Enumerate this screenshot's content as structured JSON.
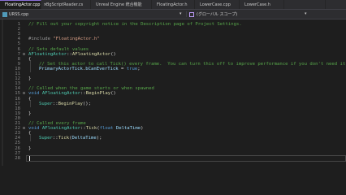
{
  "tabs": [
    {
      "label": "FloatingActor.cpp",
      "active": true
    },
    {
      "label": "BgScriptReader.cs",
      "active": false
    },
    {
      "label": "Unreal Engine 統合機能",
      "active": false
    },
    {
      "label": "FloatingActor.h",
      "active": false
    },
    {
      "label": "LowerCase.cpp",
      "active": false
    },
    {
      "label": "LowerCase.h",
      "active": false
    },
    {
      "label": "",
      "active": false
    }
  ],
  "tab_close_glyph": "×",
  "navbar": {
    "project": "URSS.cpp",
    "dropdown_glyph": "▾",
    "scope": "(グローバル スコープ)"
  },
  "lines": [
    {
      "n": "1",
      "fold": "",
      "indent": 0,
      "tokens": [
        {
          "t": "// Fill out your copyright notice in the Description page of Project Settings.",
          "c": "cmt"
        }
      ]
    },
    {
      "n": "2",
      "fold": "",
      "indent": 0,
      "tokens": []
    },
    {
      "n": "3",
      "fold": "",
      "indent": 0,
      "tokens": []
    },
    {
      "n": "4",
      "fold": "",
      "indent": 0,
      "tokens": [
        {
          "t": "#include ",
          "c": "pp"
        },
        {
          "t": "\"FloatingActor.h\"",
          "c": "str"
        }
      ]
    },
    {
      "n": "5",
      "fold": "",
      "indent": 0,
      "tokens": []
    },
    {
      "n": "6",
      "fold": "",
      "indent": 0,
      "tokens": [
        {
          "t": "// Sets default values",
          "c": "cmt"
        }
      ]
    },
    {
      "n": "7",
      "fold": "⊟",
      "indent": 0,
      "tokens": [
        {
          "t": "AFloatingActor",
          "c": "typ"
        },
        {
          "t": "::",
          "c": "pn"
        },
        {
          "t": "AFloatingActor",
          "c": "fn"
        },
        {
          "t": "()",
          "c": "pn"
        }
      ]
    },
    {
      "n": "8",
      "fold": "",
      "indent": 0,
      "tokens": [
        {
          "t": "{",
          "c": "pn"
        }
      ]
    },
    {
      "n": "9",
      "fold": "",
      "indent": 1,
      "tokens": [
        {
          "t": "// Set this actor to call Tick() every frame.  You can turn this off to improve performance if you don't need it.",
          "c": "cmt"
        }
      ]
    },
    {
      "n": "10",
      "fold": "",
      "indent": 1,
      "tokens": [
        {
          "t": "PrimaryActorTick",
          "c": "var"
        },
        {
          "t": ".",
          "c": "pn"
        },
        {
          "t": "bCanEverTick",
          "c": "var"
        },
        {
          "t": " = ",
          "c": "pn"
        },
        {
          "t": "true",
          "c": "kw"
        },
        {
          "t": ";",
          "c": "pn"
        }
      ]
    },
    {
      "n": "11",
      "fold": "",
      "indent": 0,
      "tokens": []
    },
    {
      "n": "12",
      "fold": "",
      "indent": 0,
      "tokens": [
        {
          "t": "}",
          "c": "pn"
        }
      ]
    },
    {
      "n": "13",
      "fold": "",
      "indent": 0,
      "tokens": []
    },
    {
      "n": "14",
      "fold": "",
      "indent": 0,
      "tokens": [
        {
          "t": "// Called when the game starts or when spawned",
          "c": "cmt"
        }
      ]
    },
    {
      "n": "15",
      "fold": "⊟",
      "indent": 0,
      "tokens": [
        {
          "t": "void ",
          "c": "kw"
        },
        {
          "t": "AFloatingActor",
          "c": "typ"
        },
        {
          "t": "::",
          "c": "pn"
        },
        {
          "t": "BeginPlay",
          "c": "fn"
        },
        {
          "t": "()",
          "c": "pn"
        }
      ]
    },
    {
      "n": "16",
      "fold": "",
      "indent": 0,
      "tokens": [
        {
          "t": "{",
          "c": "pn"
        }
      ]
    },
    {
      "n": "17",
      "fold": "",
      "indent": 1,
      "tokens": [
        {
          "t": "Super",
          "c": "typ"
        },
        {
          "t": "::",
          "c": "pn"
        },
        {
          "t": "BeginPlay",
          "c": "fn"
        },
        {
          "t": "();",
          "c": "pn"
        }
      ]
    },
    {
      "n": "18",
      "fold": "",
      "indent": 0,
      "tokens": []
    },
    {
      "n": "19",
      "fold": "",
      "indent": 0,
      "tokens": [
        {
          "t": "}",
          "c": "pn"
        }
      ]
    },
    {
      "n": "20",
      "fold": "",
      "indent": 0,
      "tokens": []
    },
    {
      "n": "21",
      "fold": "",
      "indent": 0,
      "tokens": [
        {
          "t": "// Called every frame",
          "c": "cmt"
        }
      ]
    },
    {
      "n": "22",
      "fold": "⊟",
      "indent": 0,
      "tokens": [
        {
          "t": "void ",
          "c": "kw"
        },
        {
          "t": "AFloatingActor",
          "c": "typ"
        },
        {
          "t": "::",
          "c": "pn"
        },
        {
          "t": "Tick",
          "c": "fn"
        },
        {
          "t": "(",
          "c": "pn"
        },
        {
          "t": "float ",
          "c": "kw"
        },
        {
          "t": "DeltaTime",
          "c": "var"
        },
        {
          "t": ")",
          "c": "pn"
        }
      ]
    },
    {
      "n": "23",
      "fold": "",
      "indent": 0,
      "tokens": [
        {
          "t": "{",
          "c": "pn"
        }
      ]
    },
    {
      "n": "24",
      "fold": "",
      "indent": 1,
      "tokens": [
        {
          "t": "Super",
          "c": "typ"
        },
        {
          "t": "::",
          "c": "pn"
        },
        {
          "t": "Tick",
          "c": "fn"
        },
        {
          "t": "(",
          "c": "pn"
        },
        {
          "t": "DeltaTime",
          "c": "var"
        },
        {
          "t": ");",
          "c": "pn"
        }
      ]
    },
    {
      "n": "25",
      "fold": "",
      "indent": 0,
      "tokens": []
    },
    {
      "n": "26",
      "fold": "",
      "indent": 0,
      "tokens": [
        {
          "t": "}",
          "c": "pn"
        }
      ]
    },
    {
      "n": "27",
      "fold": "",
      "indent": 0,
      "tokens": []
    },
    {
      "n": "28",
      "fold": "",
      "indent": 0,
      "tokens": [],
      "current": true
    }
  ],
  "colors": {
    "comment": "#57a64a",
    "keyword": "#569cd6",
    "string": "#d69d85",
    "type": "#4ec9b0",
    "function": "#dcdcaa",
    "active_tab_accent": "#8a6ed8"
  }
}
